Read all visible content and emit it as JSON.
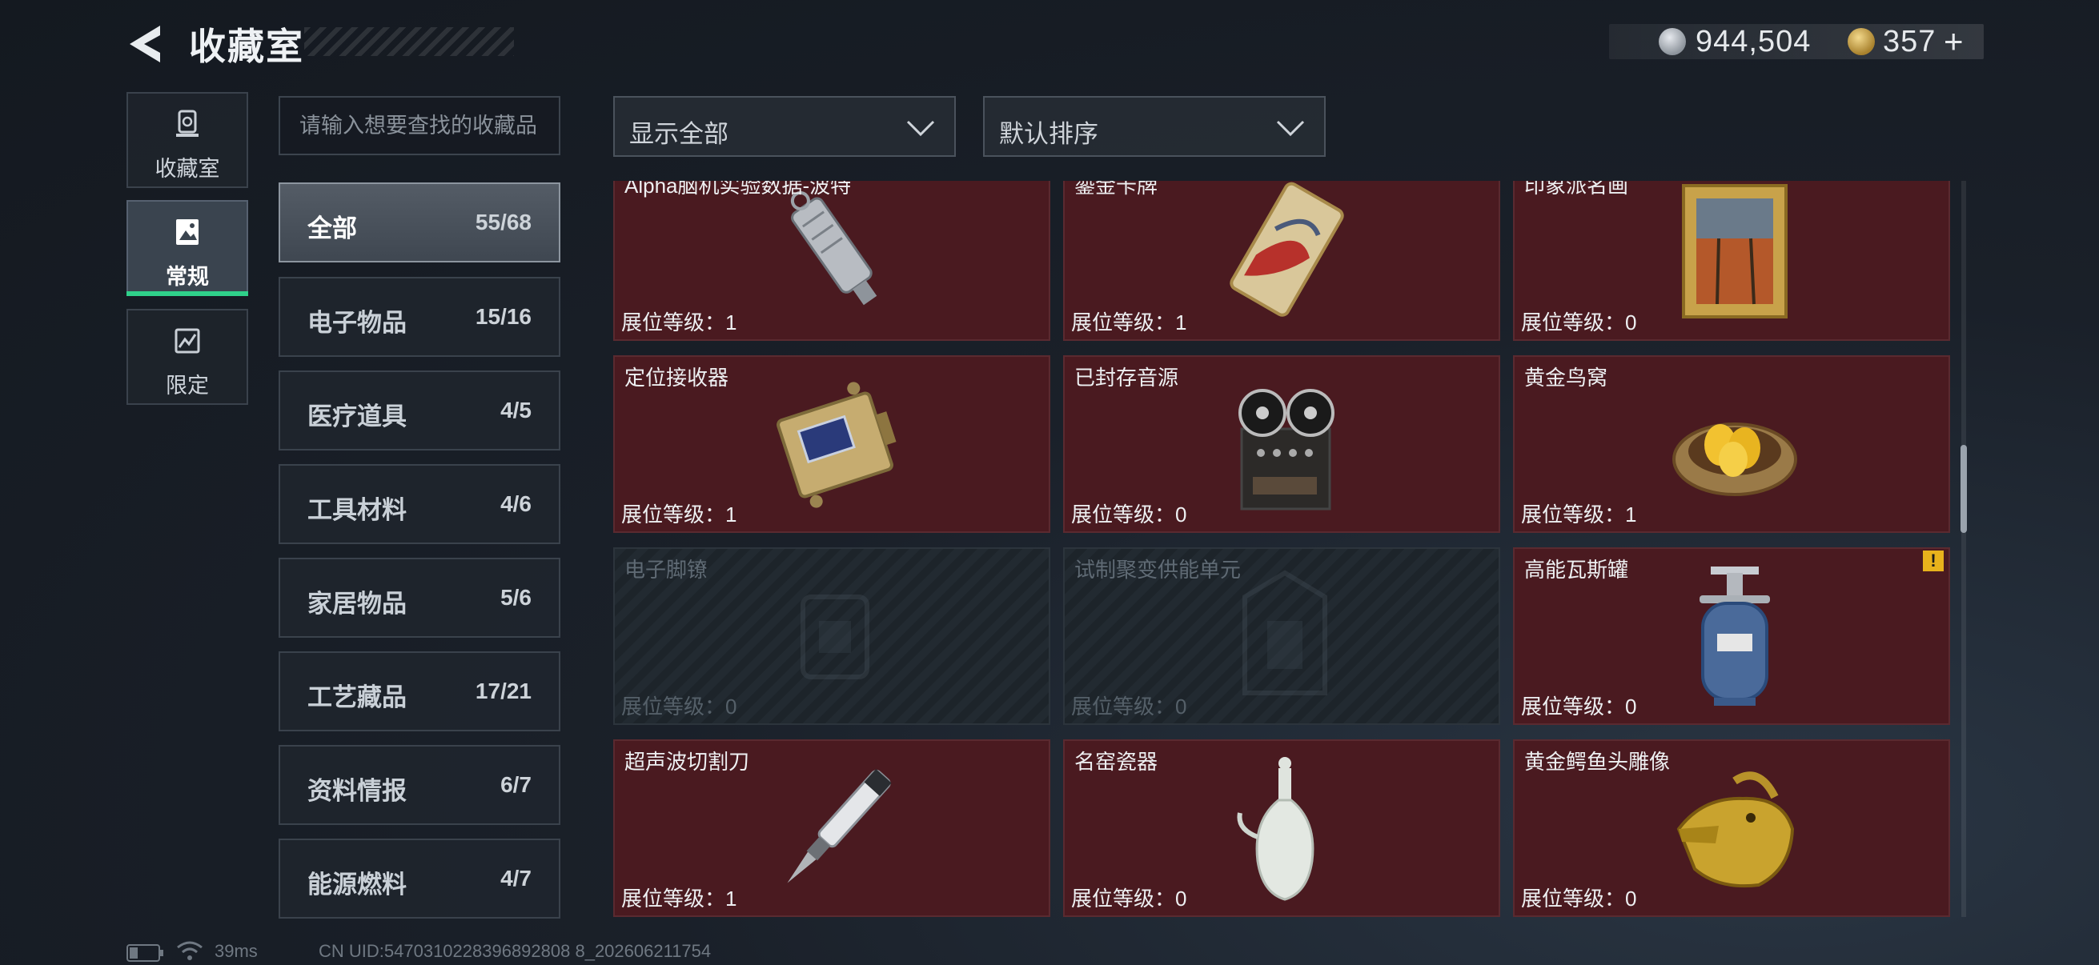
{
  "header": {
    "title": "收藏室",
    "currency_silver": "944,504",
    "currency_gold": "357",
    "add_symbol": "+"
  },
  "nav": [
    {
      "label": "收藏室",
      "icon": "trophy-icon"
    },
    {
      "label": "常规",
      "icon": "picture-icon"
    },
    {
      "label": "限定",
      "icon": "limited-icon"
    }
  ],
  "search": {
    "placeholder": "请输入想要查找的收藏品"
  },
  "categories": [
    {
      "name": "全部",
      "count": "55/68"
    },
    {
      "name": "电子物品",
      "count": "15/16"
    },
    {
      "name": "医疗道具",
      "count": "4/5"
    },
    {
      "name": "工具材料",
      "count": "4/6"
    },
    {
      "name": "家居物品",
      "count": "5/6"
    },
    {
      "name": "工艺藏品",
      "count": "17/21"
    },
    {
      "name": "资料情报",
      "count": "6/7"
    },
    {
      "name": "能源燃料",
      "count": "4/7"
    }
  ],
  "filters": {
    "show": "显示全部",
    "sort": "默认排序"
  },
  "level_prefix": "展位等级：",
  "items": [
    {
      "name": "Alpha脑机实验数据-波特",
      "level": "展位等级：1",
      "icon": "usb-drive-icon",
      "locked": false
    },
    {
      "name": "鎏金卡牌",
      "level": "展位等级：1",
      "icon": "gilded-card-icon",
      "locked": false
    },
    {
      "name": "印象派名画",
      "level": "展位等级：0",
      "icon": "framed-painting-icon",
      "locked": false
    },
    {
      "name": "定位接收器",
      "level": "展位等级：1",
      "icon": "receiver-icon",
      "locked": false
    },
    {
      "name": "已封存音源",
      "level": "展位等级：0",
      "icon": "tape-recorder-icon",
      "locked": false
    },
    {
      "name": "黄金鸟窝",
      "level": "展位等级：1",
      "icon": "golden-nest-icon",
      "locked": false
    },
    {
      "name": "电子脚镣",
      "level": "展位等级：0",
      "icon": "ankle-monitor-icon",
      "locked": true
    },
    {
      "name": "试制聚变供能单元",
      "level": "展位等级：0",
      "icon": "fusion-unit-icon",
      "locked": true
    },
    {
      "name": "高能瓦斯罐",
      "level": "展位等级：0",
      "icon": "gas-canister-icon",
      "locked": false,
      "warning": "!"
    },
    {
      "name": "超声波切割刀",
      "level": "展位等级：1",
      "icon": "ultrasonic-cutter-icon",
      "locked": false
    },
    {
      "name": "名窑瓷器",
      "level": "展位等级：0",
      "icon": "porcelain-vase-icon",
      "locked": false
    },
    {
      "name": "黄金鳄鱼头雕像",
      "level": "展位等级：0",
      "icon": "gold-crocodile-icon",
      "locked": false
    }
  ],
  "footer": {
    "ping": "39ms",
    "uid": "CN UID:5470310228396892808 8_202606211754"
  }
}
